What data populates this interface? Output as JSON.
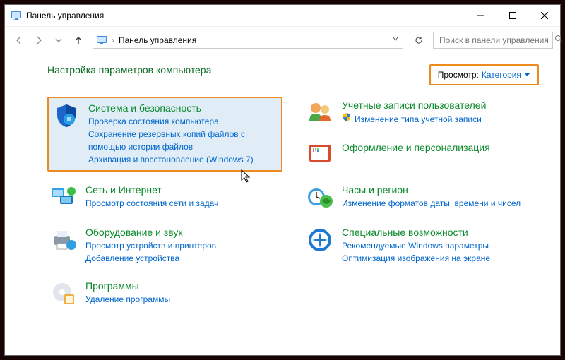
{
  "titlebar": {
    "title": "Панель управления"
  },
  "navbar": {
    "breadcrumb": "Панель управления",
    "search_placeholder": "Поиск в панели управления"
  },
  "heading": "Настройка параметров компьютера",
  "viewby": {
    "label": "Просмотр:",
    "value": "Категория"
  },
  "left": [
    {
      "title": "Система и безопасность",
      "links": [
        "Проверка состояния компьютера",
        "Сохранение резервных копий файлов с помощью истории файлов",
        "Архивация и восстановление (Windows 7)"
      ],
      "highlighted": true
    },
    {
      "title": "Сеть и Интернет",
      "links": [
        "Просмотр состояния сети и задач"
      ]
    },
    {
      "title": "Оборудование и звук",
      "links": [
        "Просмотр устройств и принтеров",
        "Добавление устройства"
      ]
    },
    {
      "title": "Программы",
      "links": [
        "Удаление программы"
      ]
    }
  ],
  "right": [
    {
      "title": "Учетные записи пользователей",
      "links": [
        "Изменение типа учетной записи"
      ],
      "shield": true
    },
    {
      "title": "Оформление и персонализация",
      "links": []
    },
    {
      "title": "Часы и регион",
      "links": [
        "Изменение форматов даты, времени и чисел"
      ]
    },
    {
      "title": "Специальные возможности",
      "links": [
        "Рекомендуемые Windows параметры",
        "Оптимизация изображения на экране"
      ]
    }
  ]
}
